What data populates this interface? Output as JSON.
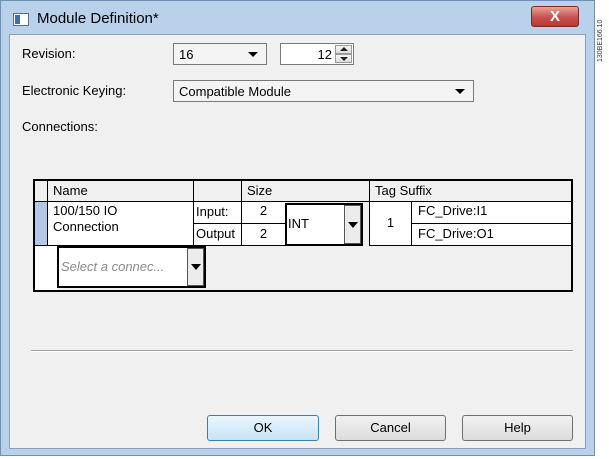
{
  "window": {
    "title": "Module Definition*",
    "close_glyph": "X",
    "side_code": "130BE166.10",
    "icon": "window-app-icon"
  },
  "form": {
    "revision_label": "Revision:",
    "revision_major": "16",
    "revision_minor": "12",
    "keying_label": "Electronic Keying:",
    "keying_value": "Compatible Module",
    "connections_label": "Connections:"
  },
  "connections_table": {
    "headers": {
      "name": "Name",
      "size": "Size",
      "tag_suffix": "Tag Suffix"
    },
    "row": {
      "name_line1": "100/150 IO",
      "name_line2": "Connection",
      "input_label": "Input:",
      "output_label": "Output",
      "input_size": "2",
      "output_size": "2",
      "data_type": "INT",
      "tag_number": "1",
      "input_tag": "FC_Drive:I1",
      "output_tag": "FC_Drive:O1"
    },
    "new_row_placeholder": "Select a connec..."
  },
  "buttons": {
    "ok": "OK",
    "cancel": "Cancel",
    "help": "Help"
  },
  "colors": {
    "title_bar": "#b9d1ea",
    "close_button": "#c75050",
    "row_selector": "#b3c7e8",
    "default_button": "#c6e4f7"
  }
}
